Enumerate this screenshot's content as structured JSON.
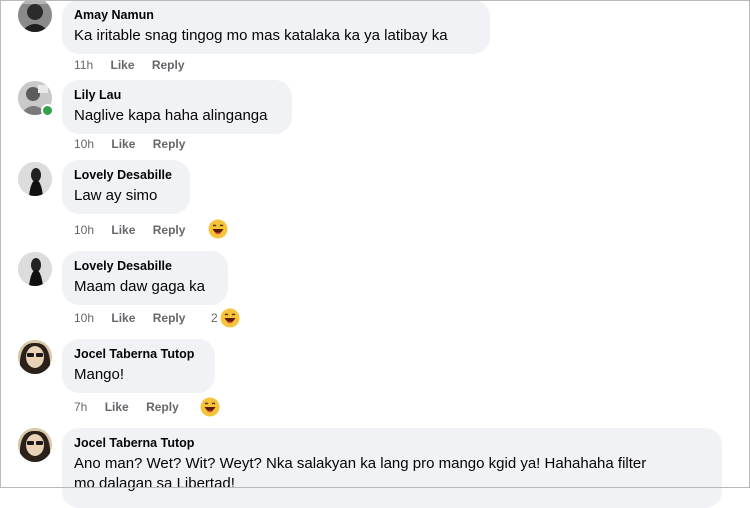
{
  "comments": [
    {
      "author": "Amay Namun",
      "text": "Ka iritable snag tingog mo mas katalaka ka ya latibay ka",
      "time": "11h",
      "like": "Like",
      "reply": "Reply"
    },
    {
      "author": "Lily Lau",
      "text": "Naglive kapa haha alinganga",
      "time": "10h",
      "like": "Like",
      "reply": "Reply"
    },
    {
      "author": "Lovely Desabille",
      "text": "Law ay simo",
      "time": "10h",
      "like": "Like",
      "reply": "Reply",
      "reaction_icon": "laughing-emoji-icon"
    },
    {
      "author": "Lovely Desabille",
      "text": "Maam daw gaga ka",
      "time": "10h",
      "like": "Like",
      "reply": "Reply",
      "reaction_count": "2",
      "reaction_icon": "laughing-emoji-icon"
    },
    {
      "author": "Jocel Taberna Tutop",
      "text": "Mango!",
      "time": "7h",
      "like": "Like",
      "reply": "Reply",
      "reaction_icon": "laughing-emoji-icon"
    },
    {
      "author": "Jocel Taberna Tutop",
      "text": "Ano man? Wet? Wit? Weyt? Nka salakyan ka lang pro mango kgid ya! Hahahaha filter",
      "text_line2": "mo dalagan sa Libertad!"
    }
  ],
  "colors": {
    "bubble": "#f0f2f5",
    "meta_text": "#65676b",
    "online": "#31a24c",
    "emoji_face": "#f7c33a"
  }
}
